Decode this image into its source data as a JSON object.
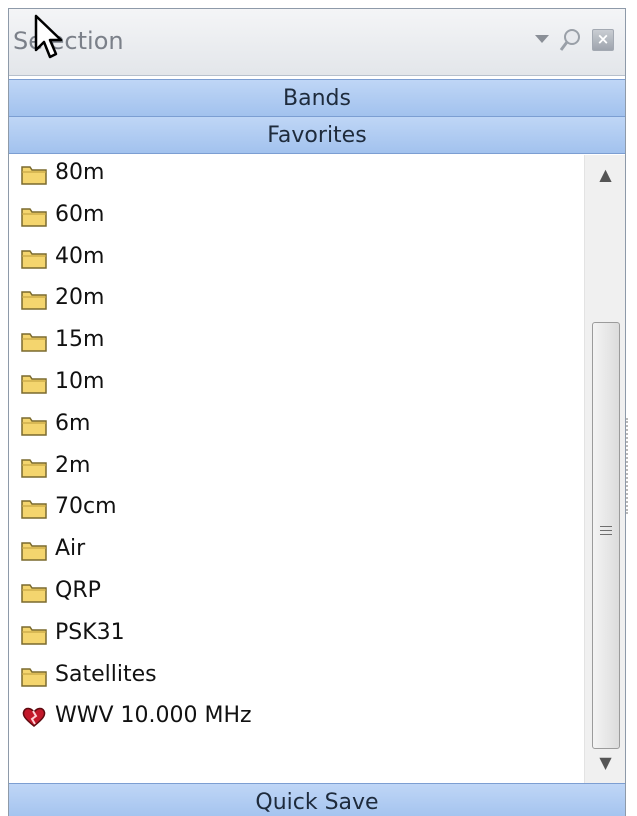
{
  "window": {
    "title": "Selection",
    "buttons": {
      "dropdown_icon": "chevron-down",
      "pin_icon": "pin",
      "close_icon": "close"
    }
  },
  "tabs": {
    "bands": "Bands",
    "favorites": "Favorites",
    "quick_save": "Quick Save"
  },
  "list": {
    "items": [
      {
        "label": "80m",
        "icon": "folder-icon"
      },
      {
        "label": "60m",
        "icon": "folder-icon"
      },
      {
        "label": "40m",
        "icon": "folder-icon"
      },
      {
        "label": "20m",
        "icon": "folder-icon"
      },
      {
        "label": "15m",
        "icon": "folder-icon"
      },
      {
        "label": "10m",
        "icon": "folder-icon"
      },
      {
        "label": "6m",
        "icon": "folder-icon"
      },
      {
        "label": "2m",
        "icon": "folder-icon"
      },
      {
        "label": "70cm",
        "icon": "folder-icon"
      },
      {
        "label": "Air",
        "icon": "folder-icon"
      },
      {
        "label": "QRP",
        "icon": "folder-icon"
      },
      {
        "label": "PSK31",
        "icon": "folder-icon"
      },
      {
        "label": "Satellites",
        "icon": "folder-icon"
      },
      {
        "label": "WWV 10.000 MHz",
        "icon": "broken-heart-icon"
      }
    ]
  },
  "colors": {
    "tab_fill": "#a2c2ee",
    "folder": "#f4d56e",
    "heart": "#c2182a"
  }
}
